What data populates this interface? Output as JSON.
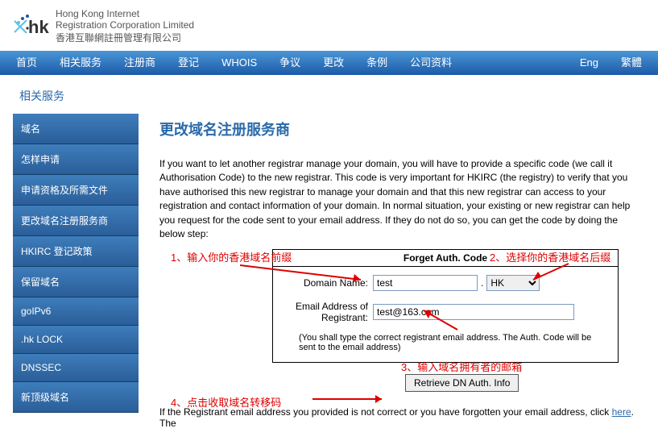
{
  "brand": {
    "mark": ".hk",
    "line1": "Hong Kong Internet",
    "line2": "Registration Corporation Limited",
    "line3": "香港互聯網註冊管理有限公司"
  },
  "nav": {
    "items": [
      "首页",
      "相关服务",
      "注册商",
      "登记",
      "WHOIS",
      "争议",
      "更改",
      "条例",
      "公司资料"
    ],
    "lang": [
      "Eng",
      "繁體"
    ]
  },
  "section_title": "相关服务",
  "sidebar": {
    "items": [
      "域名",
      "怎样申请",
      "申请资格及所需文件",
      "更改域名注册服务商",
      "HKIRC 登记政策",
      "保留域名",
      "goIPv6",
      ".hk LOCK",
      "DNSSEC",
      "新顶级域名"
    ]
  },
  "page": {
    "title": "更改域名注册服务商",
    "intro": "If you want to let another registrar manage your domain, you will have to provide a specific code (we call it Authorisation Code) to the new registrar. This code is very important for HKIRC (the registry) to verify that you have authorised this new registrar to manage your domain and that this new registrar can access to your registration and contact information of your domain. In normal situation, your existing or new registrar can help you request for the code sent to your email address. If they do not do so, you can get the code by doing the below step:",
    "annot1": "1、输入你的香港域名前缀",
    "annot2": "2、选择你的香港域名后缀",
    "annot3": "3、输入域名拥有者的邮箱",
    "annot4": "4、点击收取域名转移码",
    "form": {
      "title": "Forget Auth. Code",
      "dn_label": "Domain Name:",
      "dn_value": "test",
      "dot": ".",
      "suffix": "HK",
      "email_label": "Email Address of Registrant:",
      "email_value": "test@163.com",
      "note": "(You shall type the correct registrant email address. The Auth. Code will be sent to the email address)",
      "button": "Retrieve DN Auth. Info"
    },
    "footer_prefix": "If the Registrant email address you provided is not correct or you have forgotten your email address, click ",
    "footer_link": "here",
    "footer_suffix": ". The"
  }
}
